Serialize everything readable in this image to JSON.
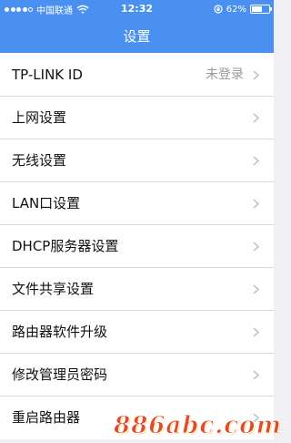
{
  "status_bar": {
    "carrier": "中国联通",
    "time": "12:32",
    "battery_text": "62%",
    "battery_level": 0.62,
    "signal_bars_filled": 4,
    "signal_bars_total": 5
  },
  "header": {
    "title": "设置",
    "background": "#4a90f0"
  },
  "settings": {
    "items": [
      {
        "label": "TP-LINK ID",
        "value": "未登录"
      },
      {
        "label": "上网设置"
      },
      {
        "label": "无线设置"
      },
      {
        "label": "LAN口设置"
      },
      {
        "label": "DHCP服务器设置"
      },
      {
        "label": "文件共享设置"
      },
      {
        "label": "路由器软件升级"
      },
      {
        "label": "修改管理员密码"
      },
      {
        "label": "重启路由器"
      }
    ]
  },
  "watermark": {
    "text": "886abc.com",
    "color": "#e24a2a"
  },
  "icons": {
    "row_arrow": "chevron-right-icon",
    "wifi": "wifi-icon",
    "lock": "rotation-lock-icon",
    "battery": "battery-icon"
  }
}
